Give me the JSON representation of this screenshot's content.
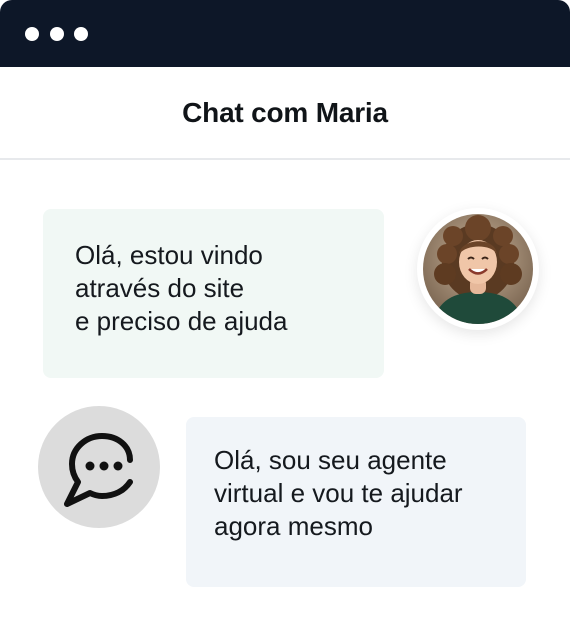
{
  "window": {
    "controls": [
      "dot",
      "dot",
      "dot"
    ]
  },
  "chat": {
    "title": "Chat com Maria"
  },
  "messages": [
    {
      "sender": "user",
      "lines": [
        "Olá, estou vindo",
        "através do site",
        "e preciso de ajuda"
      ],
      "avatar_icon": "user-photo-avatar",
      "bubble_color": "#f1f8f5"
    },
    {
      "sender": "agent",
      "lines": [
        "Olá, sou seu agente",
        "virtual e vou te ajudar",
        "agora mesmo"
      ],
      "avatar_icon": "chat-bubble-dots-icon",
      "bubble_color": "#f1f5f9"
    }
  ],
  "colors": {
    "titlebar": "#0d1728",
    "text": "#15191e",
    "agent_icon_bg": "#dcdcdc"
  }
}
